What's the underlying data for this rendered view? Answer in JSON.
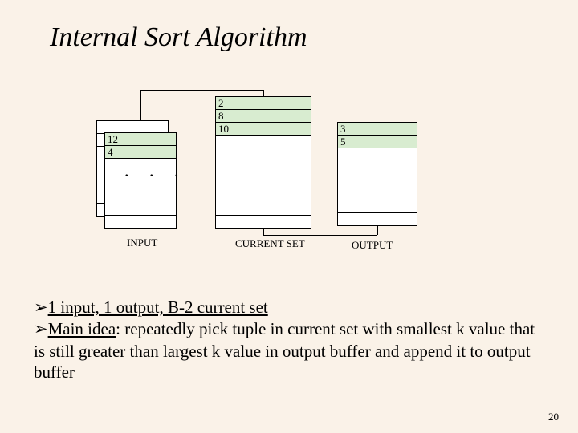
{
  "title": "Internal Sort Algorithm",
  "input": {
    "r1": "12",
    "r2": "4",
    "dots": ".  .  .",
    "label": "INPUT"
  },
  "current": {
    "r1": "2",
    "r2": "8",
    "r3": "10",
    "label": "CURRENT SET"
  },
  "output": {
    "r1": "3",
    "r2": "5",
    "label": "OUTPUT"
  },
  "bullet1_lead": "1 input, 1 output, B-2 current set",
  "bullet2_lead": "Main idea",
  "bullet2_rest": ": repeatedly pick tuple in  current set with smallest k value that is still greater than largest k value in output buffer and append it to output buffer",
  "arrow_glyph": "➢",
  "page": "20"
}
